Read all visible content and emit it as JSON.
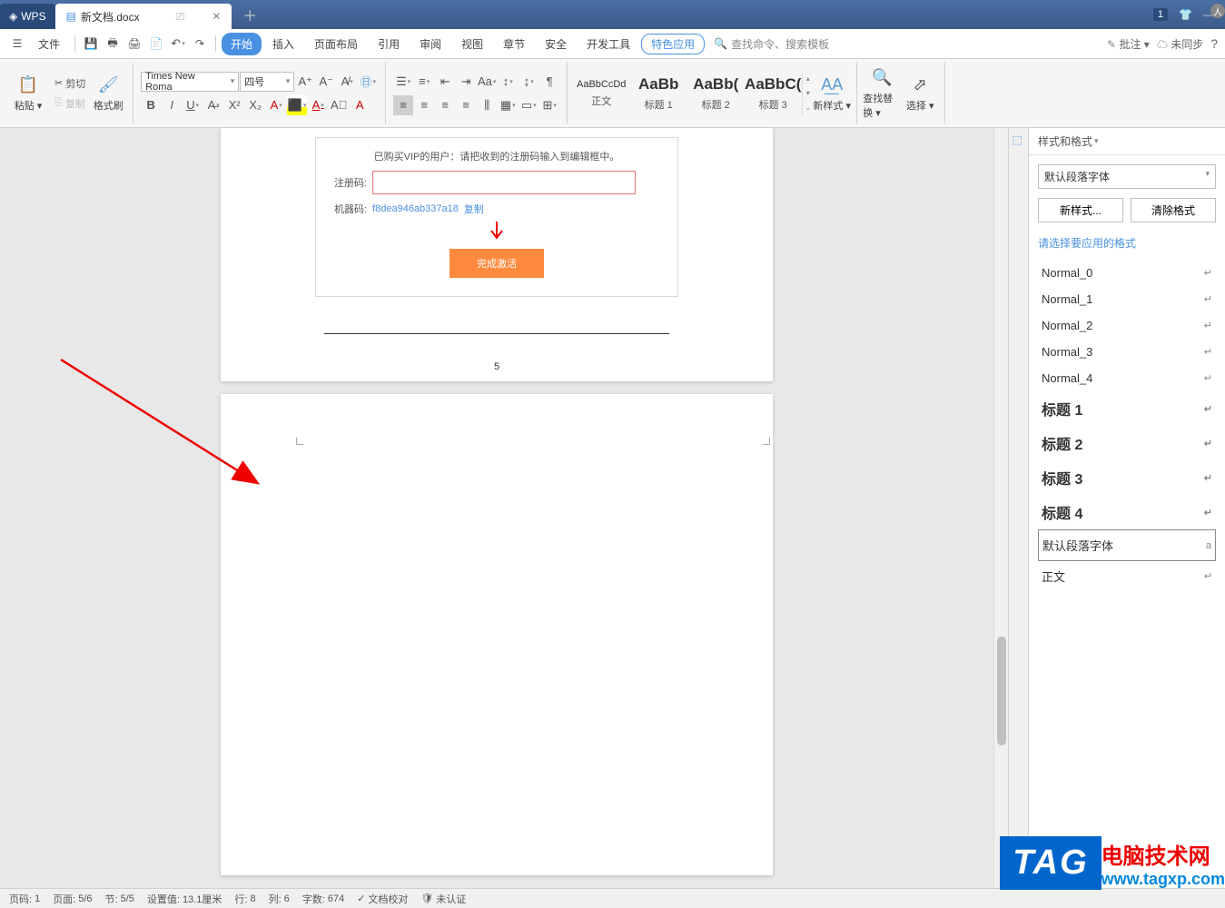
{
  "titlebar": {
    "home_tab": "WPS",
    "doc_tab": "新文档.docx",
    "badge": "1"
  },
  "menubar": {
    "file": "文件",
    "tabs": [
      "开始",
      "插入",
      "页面布局",
      "引用",
      "审阅",
      "视图",
      "章节",
      "安全",
      "开发工具",
      "特色应用"
    ],
    "search_placeholder": "查找命令、搜索模板",
    "annotate": "批注",
    "sync": "未同步"
  },
  "ribbon": {
    "paste": "粘贴",
    "cut": "剪切",
    "copy": "复制",
    "format_painter": "格式刷",
    "font_name": "Times New Roma",
    "font_size": "四号",
    "styles": [
      {
        "preview": "AaBbCcDd",
        "label": "正文"
      },
      {
        "preview": "AaBb",
        "label": "标题 1"
      },
      {
        "preview": "AaBb(",
        "label": "标题 2"
      },
      {
        "preview": "AaBbC(",
        "label": "标题 3"
      }
    ],
    "new_style": "新样式",
    "find_replace": "查找替换",
    "select": "选择"
  },
  "doc": {
    "vip_hint": "已购买VIP的用户：请把收到的注册码输入到编辑框中。",
    "reg_label": "注册码:",
    "machine_label": "机器码:",
    "machine_code": "f8dea946ab337a18",
    "copy": "复制",
    "activate_btn": "完成激活",
    "page_num": "5"
  },
  "panel": {
    "title": "样式和格式",
    "current": "默认段落字体",
    "new_style_btn": "新样式...",
    "clear_btn": "清除格式",
    "hint": "请选择要应用的格式",
    "list": [
      {
        "name": "Normal_0",
        "h": false
      },
      {
        "name": "Normal_1",
        "h": false
      },
      {
        "name": "Normal_2",
        "h": false
      },
      {
        "name": "Normal_3",
        "h": false
      },
      {
        "name": "Normal_4",
        "h": false
      },
      {
        "name": "标题 1",
        "h": true
      },
      {
        "name": "标题 2",
        "h": true
      },
      {
        "name": "标题 3",
        "h": true
      },
      {
        "name": "标题 4",
        "h": true
      },
      {
        "name": "默认段落字体",
        "h": false,
        "sel": true,
        "ret": "a"
      },
      {
        "name": "正文",
        "h": false
      }
    ]
  },
  "status": {
    "page_label": "页码:",
    "page": "1",
    "pages_label": "页面:",
    "pages": "5/6",
    "section_label": "节:",
    "section": "5/5",
    "pos_label": "设置值:",
    "pos": "13.1厘米",
    "row_label": "行:",
    "row": "8",
    "col_label": "列:",
    "col": "6",
    "words_label": "字数:",
    "words": "674",
    "proof": "文档校对",
    "auth": "未认证"
  },
  "watermark": {
    "tag": "TAG",
    "line1": "电脑技术网",
    "line2": "www.tagxp.com"
  }
}
